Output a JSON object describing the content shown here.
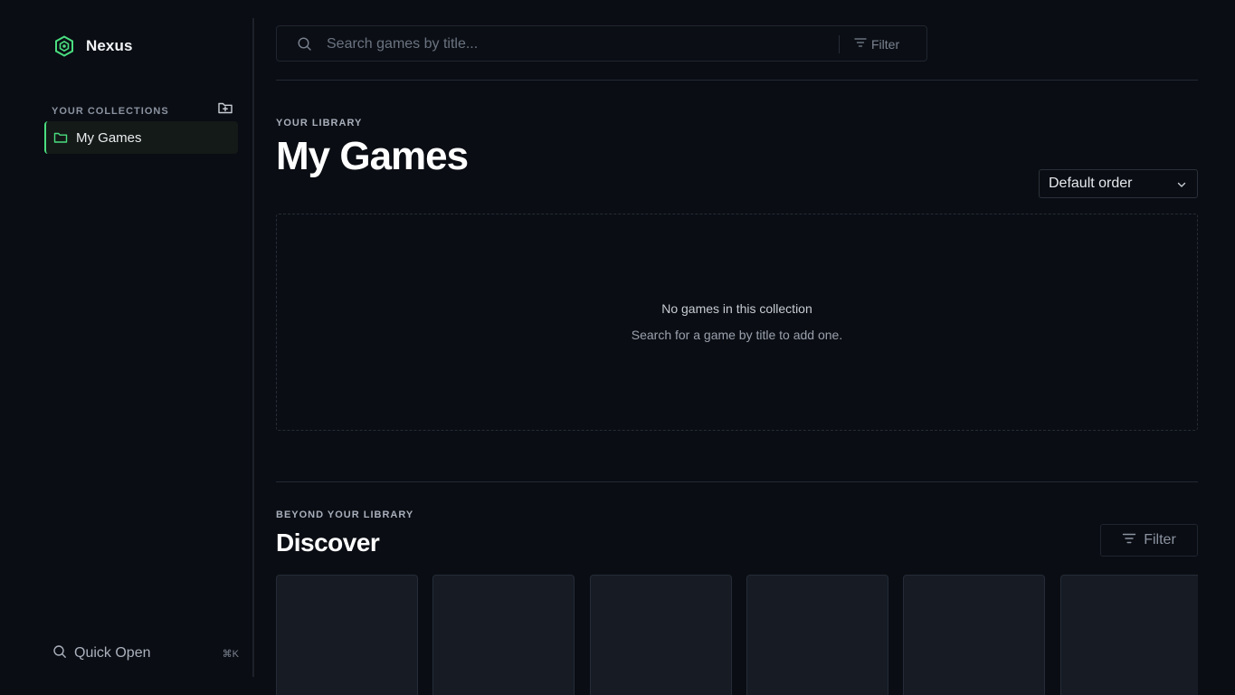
{
  "app": {
    "name": "Nexus"
  },
  "sidebar": {
    "collections_title": "YOUR COLLECTIONS",
    "items": [
      {
        "label": "My Games",
        "active": true
      }
    ],
    "quick_open": {
      "label": "Quick Open",
      "shortcut": "⌘K"
    }
  },
  "search": {
    "placeholder": "Search games by title...",
    "value": "",
    "filter_label": "Filter"
  },
  "library": {
    "eyebrow": "YOUR LIBRARY",
    "title": "My Games",
    "sort": {
      "selected": "Default order"
    },
    "empty": {
      "title": "No games in this collection",
      "subtitle": "Search for a game by title to add one."
    }
  },
  "discover": {
    "eyebrow": "BEYOND YOUR LIBRARY",
    "title": "Discover",
    "filter_label": "Filter",
    "cards": [
      {},
      {},
      {},
      {},
      {},
      {}
    ]
  },
  "colors": {
    "background": "#0a0d13",
    "accent": "#4ade80",
    "card": "#161b24",
    "border": "#262c37"
  },
  "icons": {
    "brand": "hexagon-logo-icon",
    "add_collection": "folder-plus-icon",
    "collection": "folder-icon",
    "quick_open": "search-icon",
    "search": "search-icon",
    "filter": "filter-icon",
    "sort": "chevron-down-icon"
  }
}
